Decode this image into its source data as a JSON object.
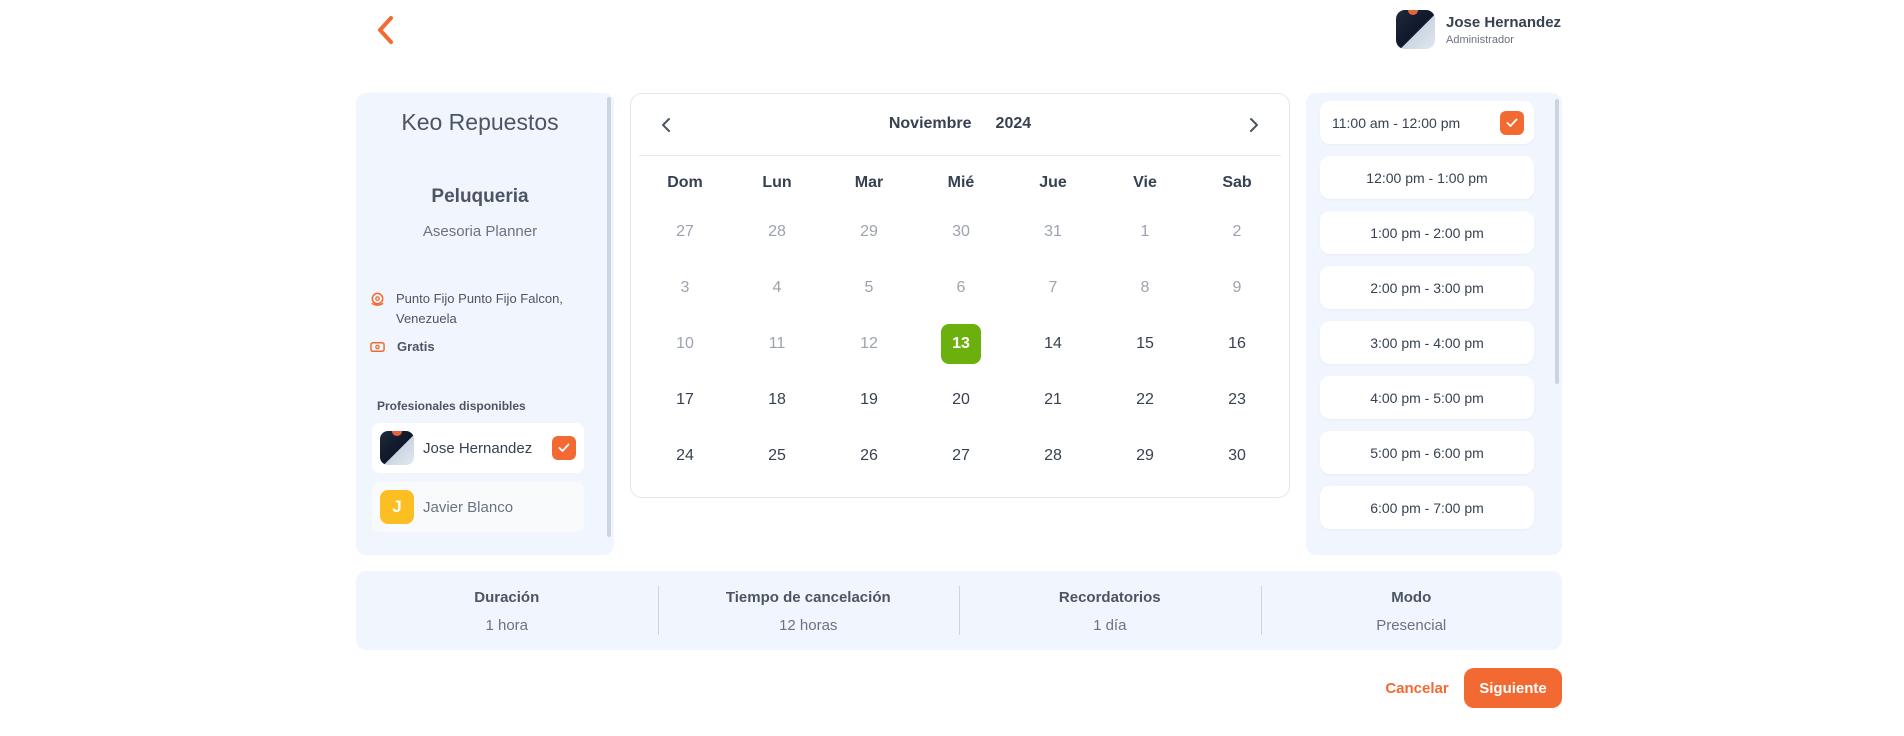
{
  "user": {
    "name": "Jose Hernandez",
    "role": "Administrador"
  },
  "business": {
    "name": "Keo Repuestos",
    "service": "Peluqueria",
    "subtitle": "Asesoria Planner",
    "address": "Punto Fijo Punto Fijo Falcon, Venezuela",
    "price": "Gratis"
  },
  "professionals": {
    "label": "Profesionales disponibles",
    "items": [
      {
        "name": "Jose Hernandez",
        "selected": true
      },
      {
        "name": "Javier Blanco",
        "initial": "J",
        "selected": false
      }
    ]
  },
  "calendar": {
    "month": "Noviembre",
    "year": "2024",
    "weekdays": [
      "Dom",
      "Lun",
      "Mar",
      "Mié",
      "Jue",
      "Vie",
      "Sab"
    ],
    "weeks": [
      [
        "27",
        "28",
        "29",
        "30",
        "31",
        "1",
        "2"
      ],
      [
        "3",
        "4",
        "5",
        "6",
        "7",
        "8",
        "9"
      ],
      [
        "10",
        "11",
        "12",
        "13",
        "14",
        "15",
        "16"
      ],
      [
        "17",
        "18",
        "19",
        "20",
        "21",
        "22",
        "23"
      ],
      [
        "24",
        "25",
        "26",
        "27",
        "28",
        "29",
        "30"
      ]
    ],
    "selected_day": "13"
  },
  "slots": {
    "items": [
      "11:00 am - 12:00 pm",
      "12:00 pm - 1:00 pm",
      "1:00 pm - 2:00 pm",
      "2:00 pm - 3:00 pm",
      "3:00 pm - 4:00 pm",
      "4:00 pm - 5:00 pm",
      "5:00 pm - 6:00 pm",
      "6:00 pm - 7:00 pm"
    ],
    "selected_index": 0
  },
  "details": [
    {
      "label": "Duración",
      "value": "1 hora"
    },
    {
      "label": "Tiempo de cancelación",
      "value": "12 horas"
    },
    {
      "label": "Recordatorios",
      "value": "1 día"
    },
    {
      "label": "Modo",
      "value": "Presencial"
    }
  ],
  "actions": {
    "cancel": "Cancelar",
    "next": "Siguiente"
  },
  "colors": {
    "accent": "#f26a32",
    "selected_day": "#6bb00c",
    "panel_bg": "#f1f5fd"
  },
  "icons": {
    "back": "chevron-left-icon",
    "address": "location-pin-icon",
    "price": "ticket-icon",
    "check": "check-icon"
  }
}
